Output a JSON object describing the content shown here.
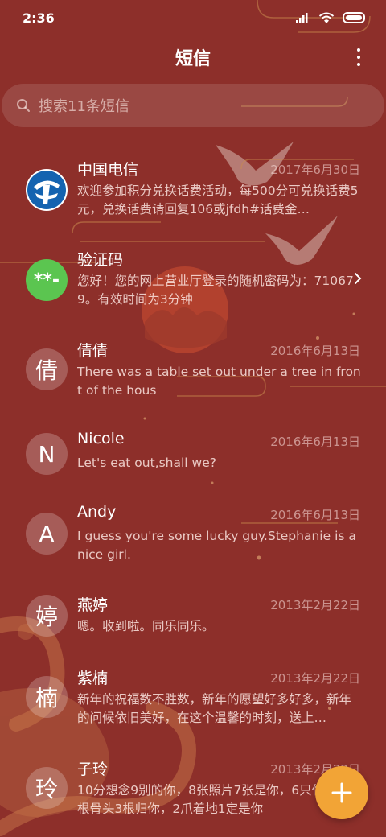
{
  "status_bar": {
    "time": "2:36"
  },
  "header": {
    "title": "短信"
  },
  "search": {
    "placeholder": "搜索11条短信"
  },
  "messages": [
    {
      "sender": "中国电信",
      "date": "2017年6月30日",
      "preview": "欢迎参加积分兑换话费活动，每500分可兑换话费5元，兑换话费请回复106或jfdh#话费金…",
      "avatar": "china-telecom-logo"
    },
    {
      "sender": "验证码",
      "date": "",
      "preview": "您好！您的网上营业厅登录的随机密码为：710679。有效时间为3分钟",
      "avatar_text": "**-",
      "avatar_color": "#5bc550"
    },
    {
      "sender": "倩倩",
      "date": "2016年6月13日",
      "preview": "There was a table set out under a tree in front of the hous",
      "avatar_text": "倩"
    },
    {
      "sender": "Nicole",
      "date": "2016年6月13日",
      "preview": "Let's eat out,shall we?",
      "avatar_text": "N"
    },
    {
      "sender": "Andy",
      "date": "2016年6月13日",
      "preview": "I guess you're some lucky guy.Stephanie is a nice girl.",
      "avatar_text": "A"
    },
    {
      "sender": "燕婷",
      "date": "2013年2月22日",
      "preview": "嗯。收到啦。同乐同乐。",
      "avatar_text": "婷"
    },
    {
      "sender": "紫楠",
      "date": "2013年2月22日",
      "preview": "新年的祝福数不胜数，新年的愿望好多好多，新年的问候依旧美好，在这个温馨的时刻，送上…",
      "avatar_text": "楠"
    },
    {
      "sender": "子玲",
      "date": "2013年2月22日",
      "preview": "10分想念9别的你，8张照片7张是你，6只像你，4根骨头3根归你，2爪着地1定是你",
      "avatar_text": "玲"
    }
  ],
  "colors": {
    "background": "#8d2f2a",
    "fab": "#f2a436",
    "verification_avatar": "#5bc550"
  },
  "icons": {
    "search": "search-icon",
    "more": "more-vertical-icon",
    "compose": "plus-icon",
    "chevron": "chevron-right-icon"
  }
}
